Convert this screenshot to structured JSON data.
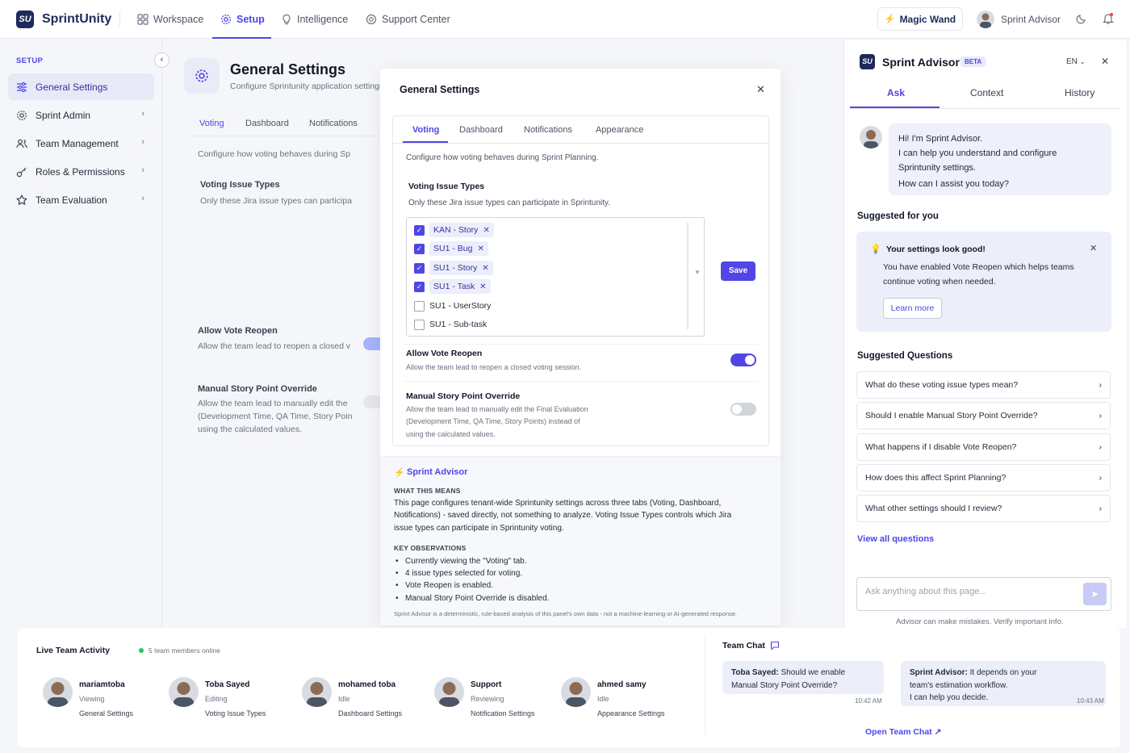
{
  "app": {
    "logo_text": "SU",
    "brand": "SprintUnity"
  },
  "nav": [
    {
      "label": "Workspace",
      "icon": "grid-icon"
    },
    {
      "label": "Setup",
      "icon": "gear-icon"
    },
    {
      "label": "Intelligence",
      "icon": "bulb-icon"
    },
    {
      "label": "Support Center",
      "icon": "lifebuoy-icon"
    }
  ],
  "topright": {
    "magic_wand": "Magic Wand",
    "advisor_name": "Sprint Advisor"
  },
  "sidebar": {
    "section": "SETUP",
    "items": [
      {
        "label": "General Settings"
      },
      {
        "label": "Sprint Admin"
      },
      {
        "label": "Team Management"
      },
      {
        "label": "Roles & Permissions"
      },
      {
        "label": "Team Evaluation"
      }
    ]
  },
  "page": {
    "title": "General Settings",
    "subtitle": "Configure Sprintunity application settings.",
    "tabs": [
      "Voting",
      "Dashboard",
      "Notifications"
    ],
    "desc": "Configure how voting behaves during Sp",
    "vit_title": "Voting Issue Types",
    "vit_sub": "Only these Jira issue types can participa",
    "reopen_title": "Allow Vote Reopen",
    "reopen_sub": "Allow the team lead to reopen a closed v",
    "override_title": "Manual Story Point Override",
    "override_l1": "Allow the team lead to manually edit the",
    "override_l2": "(Development Time, QA Time, Story Poin",
    "override_l3": "using the calculated values."
  },
  "modal": {
    "title": "General Settings",
    "tabs": [
      "Voting",
      "Dashboard",
      "Notifications",
      "Appearance"
    ],
    "desc": "Configure how voting behaves during Sprint Planning.",
    "vit_title": "Voting Issue Types",
    "vit_sub": "Only these Jira issue types can participate in Sprintunity.",
    "options": [
      {
        "label": "KAN - Story",
        "checked": true
      },
      {
        "label": "SU1 - Bug",
        "checked": true
      },
      {
        "label": "SU1 - Story",
        "checked": true
      },
      {
        "label": "SU1 - Task",
        "checked": true
      },
      {
        "label": "SU1 - UserStory",
        "checked": false
      },
      {
        "label": "SU1 - Sub-task",
        "checked": false
      }
    ],
    "save": "Save",
    "reopen_title": "Allow Vote Reopen",
    "reopen_sub": "Allow the team lead to reopen a closed voting session.",
    "reopen_on": true,
    "override_title": "Manual Story Point Override",
    "override_l1": "Allow the team lead to manually edit the Final Evaluation",
    "override_l2": "(Development Time, QA Time, Story Points) instead of",
    "override_l3": "using the calculated values.",
    "override_on": false,
    "advisor": {
      "title": "Sprint Advisor",
      "means_h": "WHAT THIS MEANS",
      "means_l1": "This page configures tenant-wide Sprintunity settings across three tabs (Voting, Dashboard,",
      "means_l2": "Notifications) - saved directly, not something to analyze. Voting Issue Types controls which Jira",
      "means_l3": "issue types can participate in Sprintunity voting.",
      "obs_h": "KEY OBSERVATIONS",
      "obs": [
        "Currently viewing the \"Voting\" tab.",
        "4 issue types selected for voting.",
        "Vote Reopen is enabled.",
        "Manual Story Point Override is disabled."
      ],
      "footer": "Sprint Advisor is a deterministic, rule-based analysis of this panel's own data - not a machine-learning or AI-generated response."
    }
  },
  "panel": {
    "logo_text": "SU",
    "title": "Sprint Advisor",
    "beta": "BETA",
    "lang": "EN",
    "tabs": [
      "Ask",
      "Context",
      "History"
    ],
    "greeting": [
      "Hi! I'm Sprint Advisor.",
      "I can help you understand and configure",
      "Sprintunity settings.",
      "How can I assist you today?"
    ],
    "suggested_title": "Suggested for you",
    "card_title": "Your settings look good!",
    "card_l1": "You have enabled Vote Reopen which helps teams",
    "card_l2": "continue voting when needed.",
    "learn_more": "Learn more",
    "questions_title": "Suggested Questions",
    "questions": [
      "What do these voting issue types mean?",
      "Should I enable Manual Story Point Override?",
      "What happens if I disable Vote Reopen?",
      "How does this affect Sprint Planning?",
      "What other settings should I review?"
    ],
    "view_all": "View all questions",
    "ask_placeholder": "Ask anything about this page...",
    "disclaimer": "Advisor can make mistakes. Verify important info."
  },
  "activity": {
    "title": "Live Team Activity",
    "online": "5 team members online",
    "members": [
      {
        "name": "mariamtoba",
        "status": "Viewing",
        "page": "General Settings"
      },
      {
        "name": "Toba Sayed",
        "status": "Editing",
        "page": "Voting Issue Types"
      },
      {
        "name": "mohamed toba",
        "status": "Idle",
        "page": "Dashboard Settings"
      },
      {
        "name": "Support",
        "status": "Reviewing",
        "page": "Notification Settings"
      },
      {
        "name": "ahmed samy",
        "status": "Idle",
        "page": "Appearance Settings"
      }
    ]
  },
  "chat": {
    "title": "Team Chat",
    "messages": [
      {
        "author": "Toba Sayed:",
        "l1": "Should we enable",
        "l2": "Manual Story Point Override?",
        "time": "10:42 AM"
      },
      {
        "author": "Sprint Advisor:",
        "l1": "It depends on your",
        "l2": "team's estimation workflow.",
        "l3": "I can help you decide.",
        "time": "10:43 AM"
      }
    ],
    "open": "Open Team Chat"
  },
  "colors": {
    "accent": "#4f46e5",
    "brand": "#1e2a5a",
    "online": "#22c55e"
  }
}
